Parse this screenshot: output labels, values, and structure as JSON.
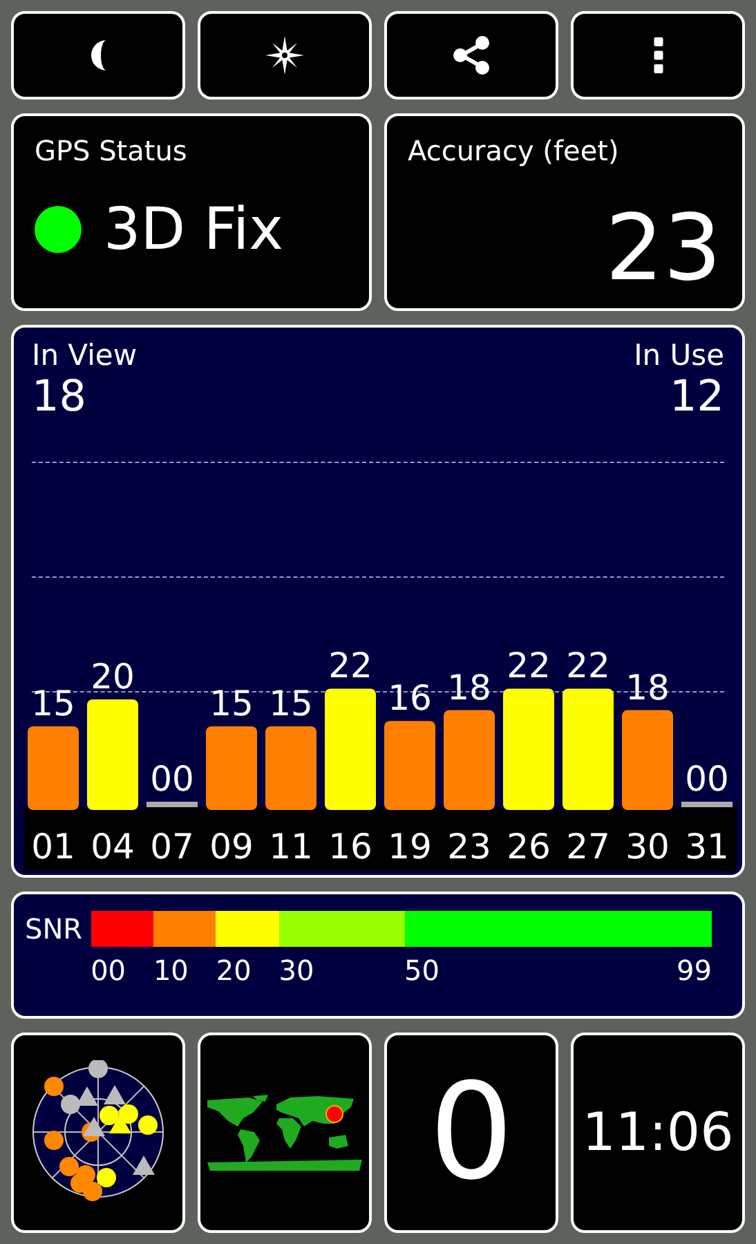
{
  "toolbar": [
    {
      "kind": "moon"
    },
    {
      "kind": "compass"
    },
    {
      "kind": "share"
    },
    {
      "kind": "more"
    }
  ],
  "gps_status": {
    "title": "GPS Status",
    "value": "3D Fix",
    "color": "#00ff00"
  },
  "accuracy": {
    "title": "Accuracy (feet)",
    "value": "23"
  },
  "satellites": {
    "in_view_label": "In View",
    "in_view": "18",
    "in_use_label": "In Use",
    "in_use": "12",
    "chart_data": {
      "type": "bar",
      "categories": [
        "01",
        "04",
        "07",
        "09",
        "11",
        "16",
        "19",
        "23",
        "26",
        "27",
        "30",
        "31"
      ],
      "values": [
        15,
        20,
        0,
        15,
        15,
        22,
        16,
        18,
        22,
        22,
        18,
        0
      ],
      "value_labels": [
        "15",
        "20",
        "00",
        "15",
        "15",
        "22",
        "16",
        "18",
        "22",
        "22",
        "18",
        "00"
      ]
    }
  },
  "snr_legend": {
    "label": "SNR",
    "segments": [
      {
        "label": "00",
        "color": "#ff0000"
      },
      {
        "label": "10",
        "color": "#ff8000"
      },
      {
        "label": "20",
        "color": "#ffff00"
      },
      {
        "label": "30",
        "color": "#99ff00"
      },
      {
        "label": "50",
        "color": "#00ff00"
      }
    ],
    "end_label": "99"
  },
  "tiles": [
    {
      "kind": "sky_plot"
    },
    {
      "kind": "world_map"
    },
    {
      "kind": "count",
      "value": "0"
    },
    {
      "kind": "clock",
      "value": "11:06"
    }
  ]
}
